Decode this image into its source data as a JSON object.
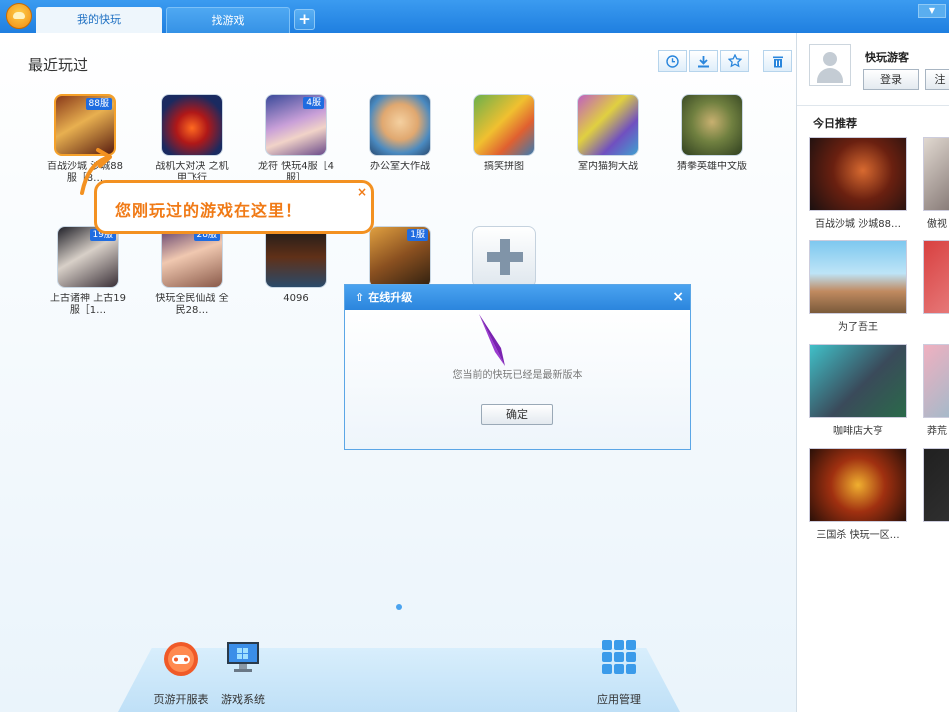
{
  "tabs": [
    {
      "label": "我的快玩"
    },
    {
      "label": "找游戏"
    }
  ],
  "tab_add_label": "+",
  "recent": {
    "title": "最近玩过",
    "games": [
      {
        "name": "百战沙城 沙城88服［8…",
        "badge": "88服"
      },
      {
        "name": "战机大对决 之机甲飞行",
        "badge": ""
      },
      {
        "name": "龙符 快玩4服［4服］",
        "badge": "4服"
      },
      {
        "name": "办公室大作战",
        "badge": ""
      },
      {
        "name": "搞笑拼图",
        "badge": ""
      },
      {
        "name": "室内猫狗大战",
        "badge": ""
      },
      {
        "name": "猜拳英雄中文版",
        "badge": ""
      },
      {
        "name": "上古诸神 上古19服［1…",
        "badge": "19服"
      },
      {
        "name": "快玩全民仙战 全民28…",
        "badge": "28服"
      },
      {
        "name": "4096",
        "badge": ""
      },
      {
        "name": "",
        "badge": "1服"
      }
    ]
  },
  "tooltip": {
    "text": "您刚玩过的游戏在这里！",
    "close": "×"
  },
  "dialog": {
    "title": "在线升级",
    "message": "您当前的快玩已经是最新版本",
    "ok": "确定",
    "close": "×"
  },
  "dock": [
    {
      "label": "页游开服表"
    },
    {
      "label": "游戏系统"
    },
    {
      "label": "应用管理"
    }
  ],
  "sidebar": {
    "guest": "快玩游客",
    "login": "登录",
    "register": "注",
    "rec_title": "今日推荐",
    "recs": [
      {
        "name": "百战沙城 沙城88…"
      },
      {
        "name": "傲视"
      },
      {
        "name": "为了吾王"
      },
      {
        "name": ""
      },
      {
        "name": "咖啡店大亨"
      },
      {
        "name": "莽荒"
      },
      {
        "name": "三国杀 快玩一区…"
      },
      {
        "name": ""
      }
    ]
  },
  "colors": {
    "accent": "#2a86dc",
    "tip": "#f39121",
    "title_bar": "#1f7fe0"
  }
}
